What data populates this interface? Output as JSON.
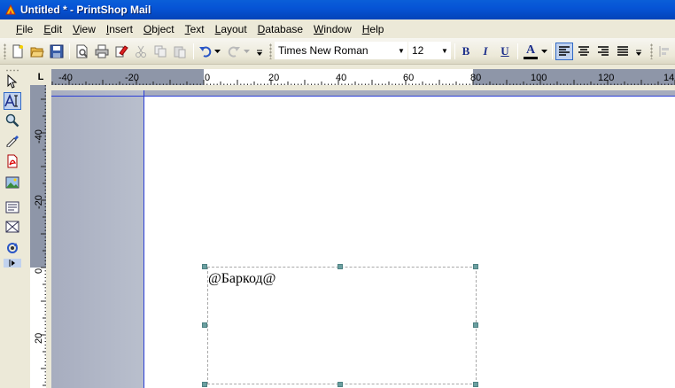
{
  "window": {
    "title": "Untitled * - PrintShop Mail"
  },
  "menu": [
    {
      "label": "File",
      "accel": "F",
      "rest": "ile"
    },
    {
      "label": "Edit",
      "accel": "E",
      "rest": "dit"
    },
    {
      "label": "View",
      "accel": "V",
      "rest": "iew"
    },
    {
      "label": "Insert",
      "accel": "I",
      "rest": "nsert"
    },
    {
      "label": "Object",
      "accel": "O",
      "rest": "bject"
    },
    {
      "label": "Text",
      "accel": "T",
      "rest": "ext"
    },
    {
      "label": "Layout",
      "accel": "L",
      "rest": "ayout"
    },
    {
      "label": "Database",
      "accel": "D",
      "rest": "atabase"
    },
    {
      "label": "Window",
      "accel": "W",
      "rest": "indow"
    },
    {
      "label": "Help",
      "accel": "H",
      "rest": "elp"
    }
  ],
  "toolbar": {
    "font_name": "Times New Roman",
    "font_size": "12",
    "bold_label": "B",
    "italic_label": "I",
    "underline_label": "U",
    "color_label": "A",
    "colors": {
      "text_color_bar": "#000000"
    }
  },
  "rulers": {
    "corner_label": "L",
    "horizontal_labels": [
      "-40",
      "-20",
      "0",
      "20",
      "40",
      "60",
      "80",
      "100",
      "120",
      "14"
    ],
    "vertical_labels": [
      "-40",
      "-20",
      "0",
      "20"
    ]
  },
  "document": {
    "textbox_content": "@Баркод@"
  },
  "icons": {
    "palette": [
      "pointer-icon",
      "text-tool-icon",
      "zoom-icon",
      "eyedropper-icon",
      "pdf-icon",
      "image-icon",
      "text-frame-icon",
      "barcode-icon",
      "rotate-icon"
    ]
  }
}
